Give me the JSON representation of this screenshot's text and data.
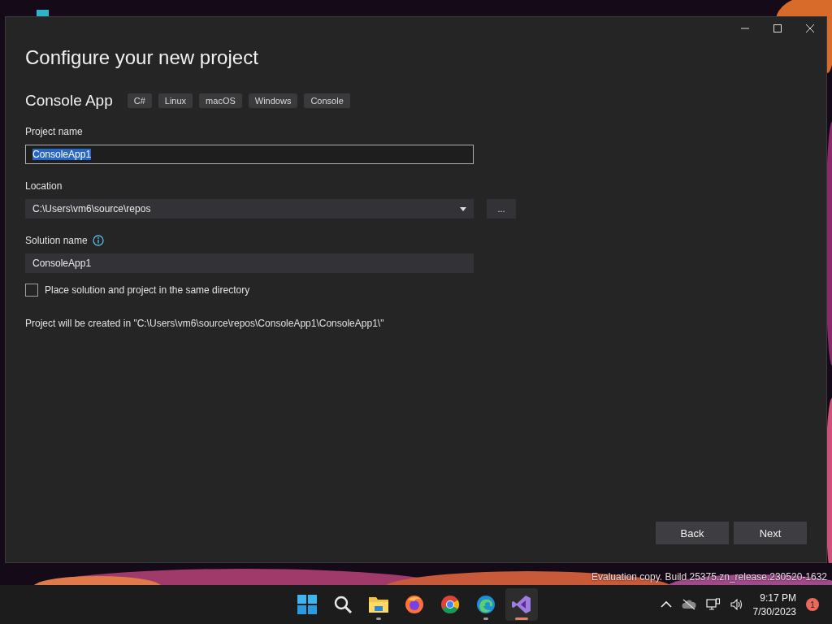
{
  "dialog": {
    "title": "Configure your new project",
    "template": "Console App",
    "tags": [
      "C#",
      "Linux",
      "macOS",
      "Windows",
      "Console"
    ],
    "project_name": {
      "label": "Project name",
      "value": "ConsoleApp1",
      "text_selected": true
    },
    "location": {
      "label": "Location",
      "value": "C:\\Users\\vm6\\source\\repos",
      "browse": "..."
    },
    "solution_name": {
      "label": "Solution name",
      "value": "ConsoleApp1"
    },
    "same_directory": {
      "label": "Place solution and project in the same directory",
      "checked": false
    },
    "path_note": "Project will be created in \"C:\\Users\\vm6\\source\\repos\\ConsoleApp1\\ConsoleApp1\\\"",
    "buttons": [
      "Back",
      "Next"
    ]
  },
  "desktop": {
    "evaluation_text": "Evaluation copy. Build 25375.zn_release.230520-1632"
  },
  "taskbar": {
    "apps": [
      {
        "kind": "start",
        "running": false,
        "active": false
      },
      {
        "kind": "search",
        "running": false,
        "active": false
      },
      {
        "kind": "folder",
        "running": true,
        "active": false
      },
      {
        "kind": "firefox",
        "running": false,
        "active": false
      },
      {
        "kind": "chrome",
        "running": false,
        "active": false
      },
      {
        "kind": "edge",
        "running": true,
        "active": false
      },
      {
        "kind": "studio",
        "running": true,
        "active": true
      }
    ],
    "time": "9:17 PM",
    "date": "7/30/2023",
    "notifications": "1"
  }
}
